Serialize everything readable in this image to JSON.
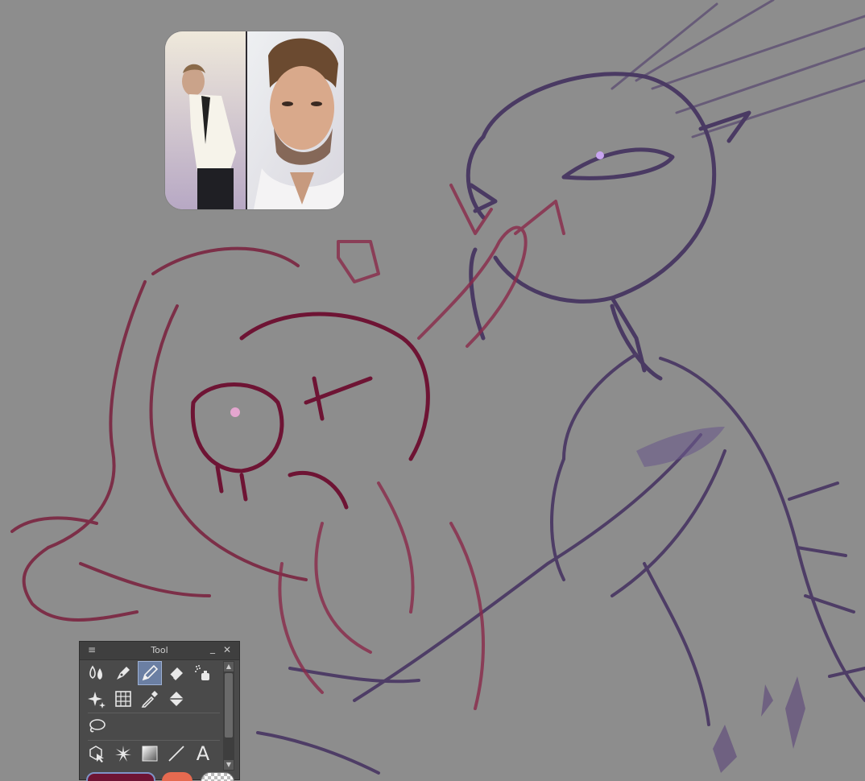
{
  "window": {
    "tool_panel_title": "Tool"
  },
  "tool_panel": {
    "menu_icon": "hamburger-icon",
    "minimize_icon": "minimize-icon",
    "close_icon": "close-icon",
    "rows": [
      [
        "blend-tool",
        "pen-tool",
        "pencil-tool",
        "eraser-tool",
        "airbrush-tool"
      ],
      [
        "sparkle-decoration-tool",
        "frame-border-tool",
        "eyedropper-tool",
        "fill-bucket-tool"
      ],
      [
        "lasso-tool"
      ],
      [
        "operation-tool",
        "auto-select-tool",
        "gradient-tool",
        "line-tool",
        "text-tool"
      ]
    ],
    "active_tool": "pencil-tool",
    "text_tool_glyph": "A"
  },
  "colors": {
    "canvas_bg": "#8d8d8d",
    "main_color": "#6e1434",
    "sub_color": "#e56a50",
    "purple_stroke": "#4e3d66",
    "red_stroke": "#7a1f3c"
  },
  "reference_image": {
    "description": "reference-photo"
  }
}
